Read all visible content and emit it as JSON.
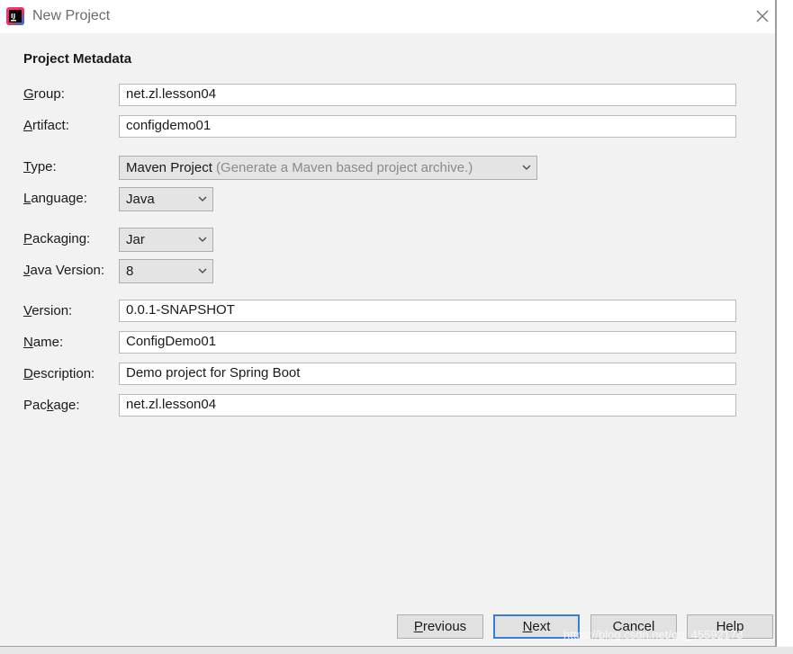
{
  "window": {
    "title": "New Project",
    "icon": "intellij-app-icon",
    "close_icon": "close-icon"
  },
  "section_title": "Project Metadata",
  "fields": {
    "group": {
      "label": "Group:",
      "mnemonic": "G",
      "value": "net.zl.lesson04"
    },
    "artifact": {
      "label": "Artifact:",
      "mnemonic": "A",
      "value": "configdemo01"
    },
    "version": {
      "label": "Version:",
      "mnemonic": "V",
      "value": "0.0.1-SNAPSHOT"
    },
    "name": {
      "label": "Name:",
      "mnemonic": "N",
      "value": "ConfigDemo01"
    },
    "description": {
      "label": "Description:",
      "mnemonic": "D",
      "value": "Demo project for Spring Boot"
    },
    "package": {
      "label": "Package:",
      "mnemonic": "k",
      "value": "net.zl.lesson04"
    }
  },
  "selects": {
    "type": {
      "label": "Type:",
      "mnemonic": "T",
      "value": "Maven Project",
      "hint": "(Generate a Maven based project archive.)"
    },
    "language": {
      "label": "Language:",
      "mnemonic": "L",
      "value": "Java"
    },
    "packaging": {
      "label": "Packaging:",
      "mnemonic": "P",
      "value": "Jar"
    },
    "java_version": {
      "label": "Java Version:",
      "mnemonic": "J",
      "value": "8"
    }
  },
  "buttons": {
    "previous": "Previous",
    "next": "Next",
    "cancel": "Cancel",
    "help": "Help"
  },
  "watermark": "https://blog.csdn.net/qq_45592178",
  "colors": {
    "dialog_bg": "#f2f2f2",
    "titlebar_bg": "#ffffff",
    "primary_border": "#3a7bd5",
    "hint_text": "#8a8a8a"
  }
}
